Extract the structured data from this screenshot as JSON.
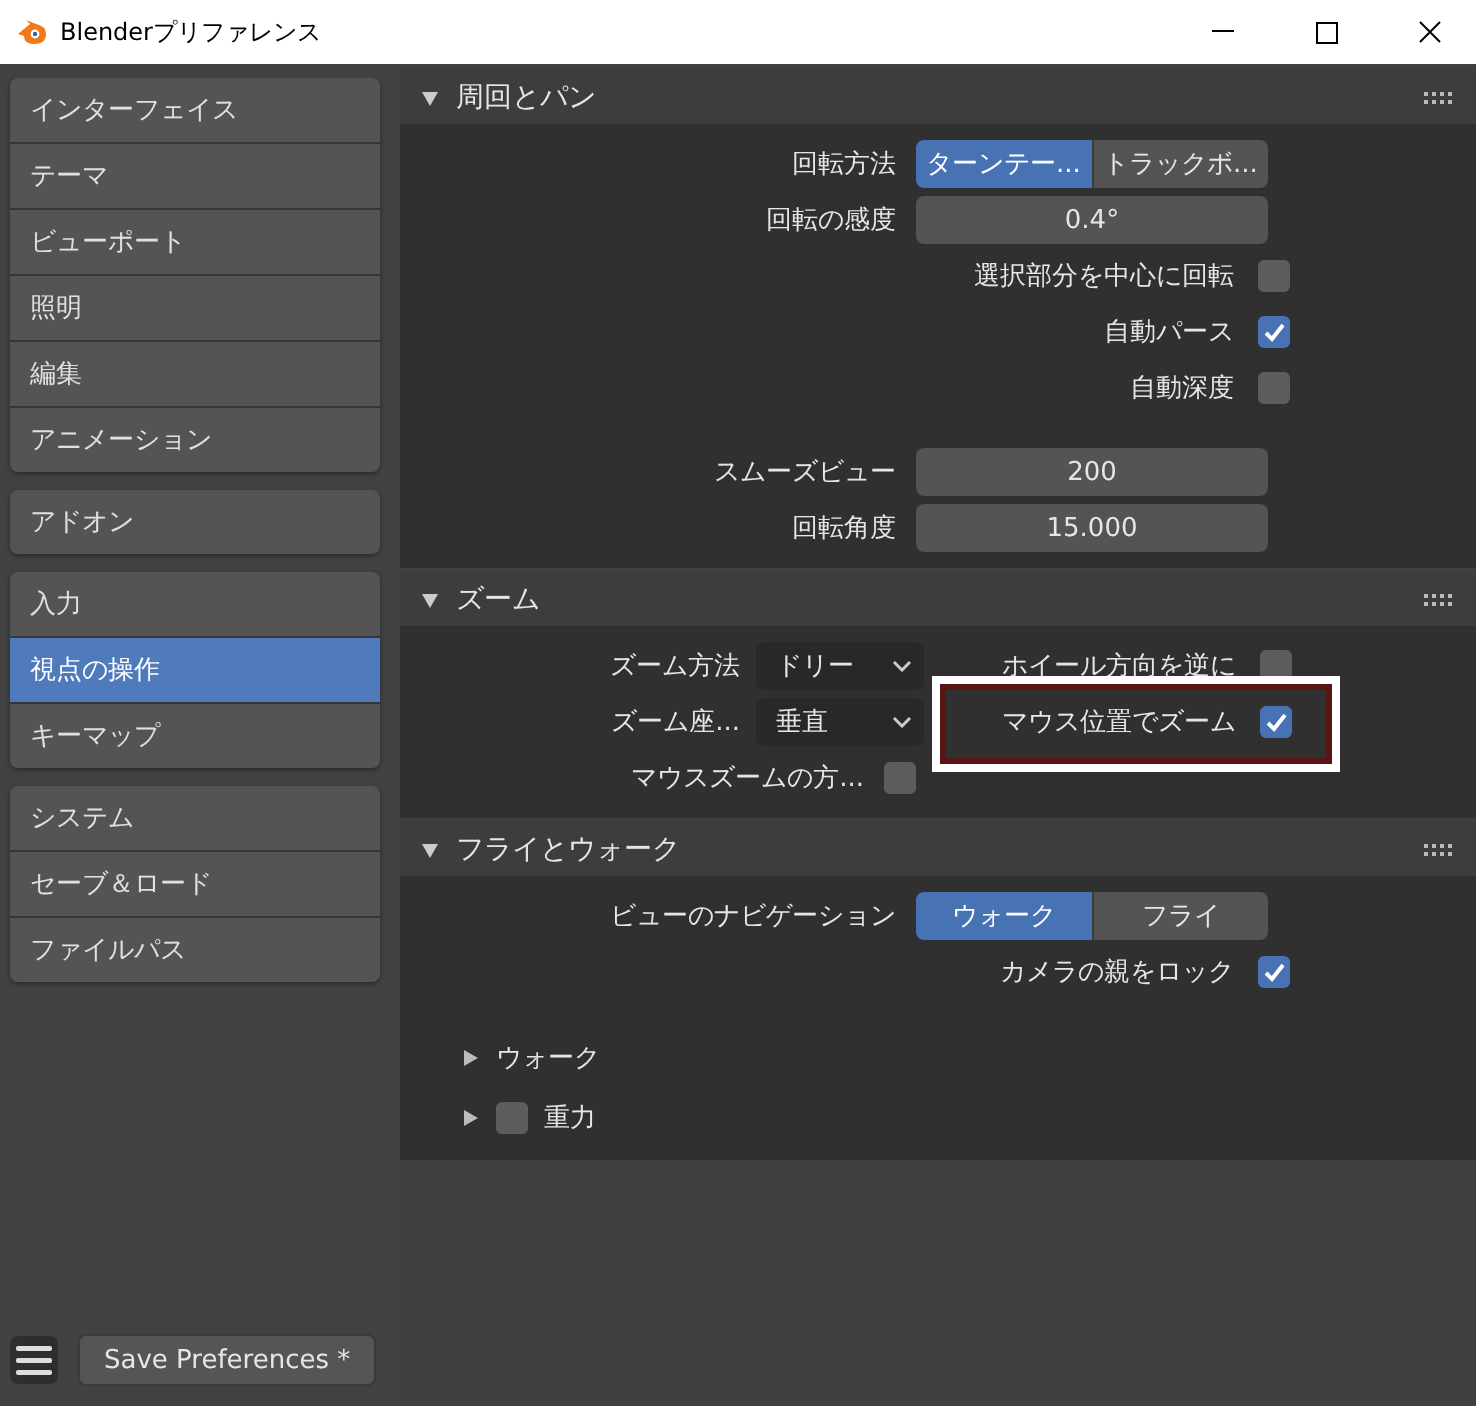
{
  "window": {
    "title": "Blenderプリファレンス"
  },
  "sidebar": {
    "groups": [
      {
        "items": [
          {
            "label": "インターフェイス",
            "selected": false
          },
          {
            "label": "テーマ",
            "selected": false
          },
          {
            "label": "ビューポート",
            "selected": false
          },
          {
            "label": "照明",
            "selected": false
          },
          {
            "label": "編集",
            "selected": false
          },
          {
            "label": "アニメーション",
            "selected": false
          }
        ]
      },
      {
        "items": [
          {
            "label": "アドオン",
            "selected": false
          }
        ]
      },
      {
        "items": [
          {
            "label": "入力",
            "selected": false
          },
          {
            "label": "視点の操作",
            "selected": true
          },
          {
            "label": "キーマップ",
            "selected": false
          }
        ]
      },
      {
        "items": [
          {
            "label": "システム",
            "selected": false
          },
          {
            "label": "セーブ＆ロード",
            "selected": false
          },
          {
            "label": "ファイルパス",
            "selected": false
          }
        ]
      }
    ]
  },
  "sections": [
    {
      "title": "周回とパン",
      "expanded": true,
      "rows": [
        {
          "kind": "segmented",
          "label": "回転方法",
          "options": [
            {
              "label": "ターンテー...",
              "selected": true
            },
            {
              "label": "トラックボ...",
              "selected": false
            }
          ]
        },
        {
          "kind": "number",
          "label": "回転の感度",
          "value": "0.4°"
        },
        {
          "kind": "checkbox",
          "label": "選択部分を中心に回転",
          "checked": false
        },
        {
          "kind": "checkbox",
          "label": "自動パース",
          "checked": true
        },
        {
          "kind": "checkbox",
          "label": "自動深度",
          "checked": false
        },
        {
          "kind": "gap"
        },
        {
          "kind": "number",
          "label": "スムーズビュー",
          "value": "200"
        },
        {
          "kind": "number",
          "label": "回転角度",
          "value": "15.000"
        }
      ]
    },
    {
      "title": "ズーム",
      "expanded": true,
      "rows": [
        {
          "kind": "split",
          "left": {
            "kind": "dropdown",
            "label": "ズーム方法",
            "value": "ドリー"
          },
          "right": {
            "label": "ホイール方向を逆に",
            "checked": false
          }
        },
        {
          "kind": "split",
          "left": {
            "kind": "dropdown",
            "label": "ズーム座...",
            "value": "垂直"
          },
          "right": {
            "label": "マウス位置でズーム",
            "checked": true,
            "highlighted": true
          }
        },
        {
          "kind": "split",
          "left": {
            "kind": "checkbox",
            "label": "マウスズームの方...",
            "checked": false
          }
        }
      ]
    },
    {
      "title": "フライとウォーク",
      "expanded": true,
      "rows": [
        {
          "kind": "segmented",
          "label": "ビューのナビゲーション",
          "options": [
            {
              "label": "ウォーク",
              "selected": true
            },
            {
              "label": "フライ",
              "selected": false
            }
          ]
        },
        {
          "kind": "checkbox",
          "label": "カメラの親をロック",
          "checked": true
        },
        {
          "kind": "gap"
        },
        {
          "kind": "subpanel",
          "label": "ウォーク",
          "expanded": false
        },
        {
          "kind": "subpanel",
          "label": "重力",
          "expanded": false,
          "checked": false
        }
      ]
    }
  ],
  "footer": {
    "save_button": "Save Preferences *"
  }
}
